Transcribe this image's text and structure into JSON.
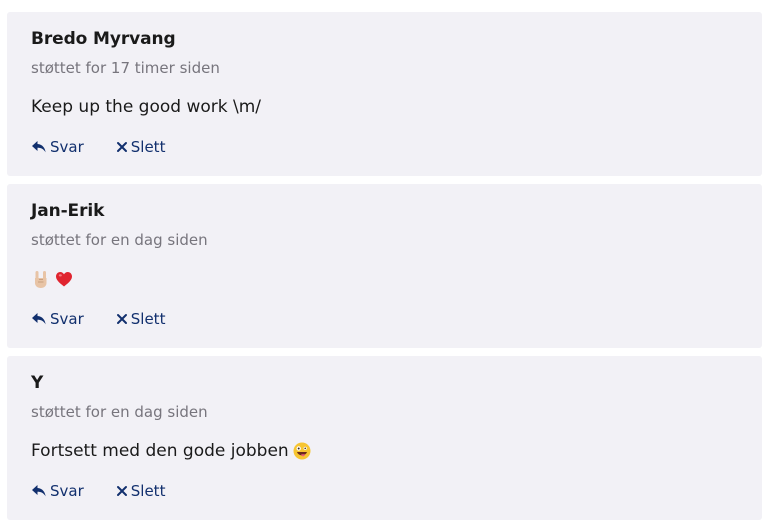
{
  "comments": [
    {
      "name": "Bredo Myrvang",
      "time": "støttet for 17 timer siden",
      "message": "Keep up the good work \\m/",
      "emojis": [],
      "reply_label": "Svar",
      "delete_label": "Slett"
    },
    {
      "name": "Jan-Erik",
      "time": "støttet for en dag siden",
      "message": "",
      "emojis": [
        "rock-on-hand",
        "red-heart"
      ],
      "reply_label": "Svar",
      "delete_label": "Slett"
    },
    {
      "name": "Y",
      "time": "støttet for en dag siden",
      "message": "Fortsett med den gode jobben",
      "emojis": [
        "zany-face"
      ],
      "reply_label": "Svar",
      "delete_label": "Slett"
    }
  ],
  "colors": {
    "card_bg": "#f2f1f6",
    "name": "#1a1a1a",
    "time": "#77757d",
    "action": "#12306e"
  },
  "icons": {
    "reply": "reply-arrow-icon",
    "delete": "close-x-icon"
  }
}
